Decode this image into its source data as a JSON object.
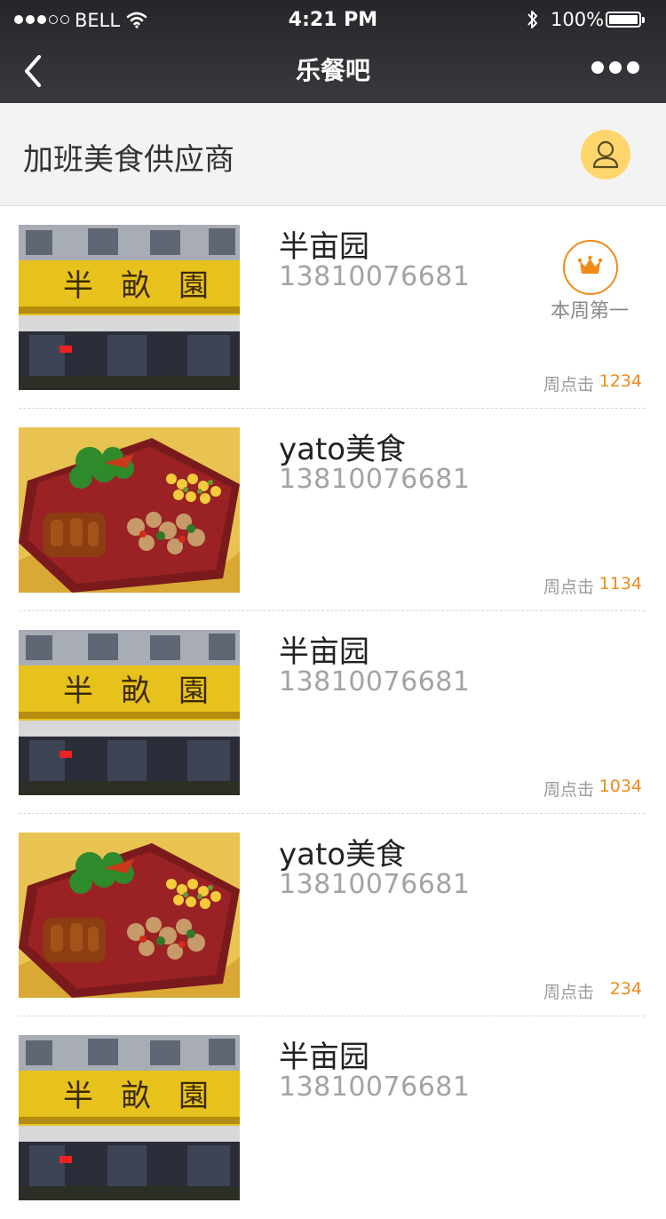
{
  "status": {
    "carrier": "BELL",
    "time": "4:21 PM",
    "battery": "100%"
  },
  "nav": {
    "title": "乐餐吧"
  },
  "section": {
    "title": "加班美食供应商"
  },
  "list": {
    "clicks_label": "周点击",
    "top_badge": "本周第一",
    "items": [
      {
        "name": "半亩园",
        "phone": "13810076681",
        "clicks": "1234",
        "image": "shopfront"
      },
      {
        "name": "yato美食",
        "phone": "13810076681",
        "clicks": "1134",
        "image": "bento"
      },
      {
        "name": "半亩园",
        "phone": "13810076681",
        "clicks": "1034",
        "image": "shopfront"
      },
      {
        "name": "yato美食",
        "phone": "13810076681",
        "clicks": "234",
        "image": "bento"
      },
      {
        "name": "半亩园",
        "phone": "13810076681",
        "clicks": "",
        "image": "shopfront"
      }
    ]
  },
  "colors": {
    "accent": "#f08a18",
    "avatar": "#ffd66b",
    "nav_bg": "#2e2e32"
  },
  "icons": {
    "back": "chevron-left-icon",
    "more": "more-dots-icon",
    "avatar": "user-icon",
    "badge": "crown-icon"
  }
}
